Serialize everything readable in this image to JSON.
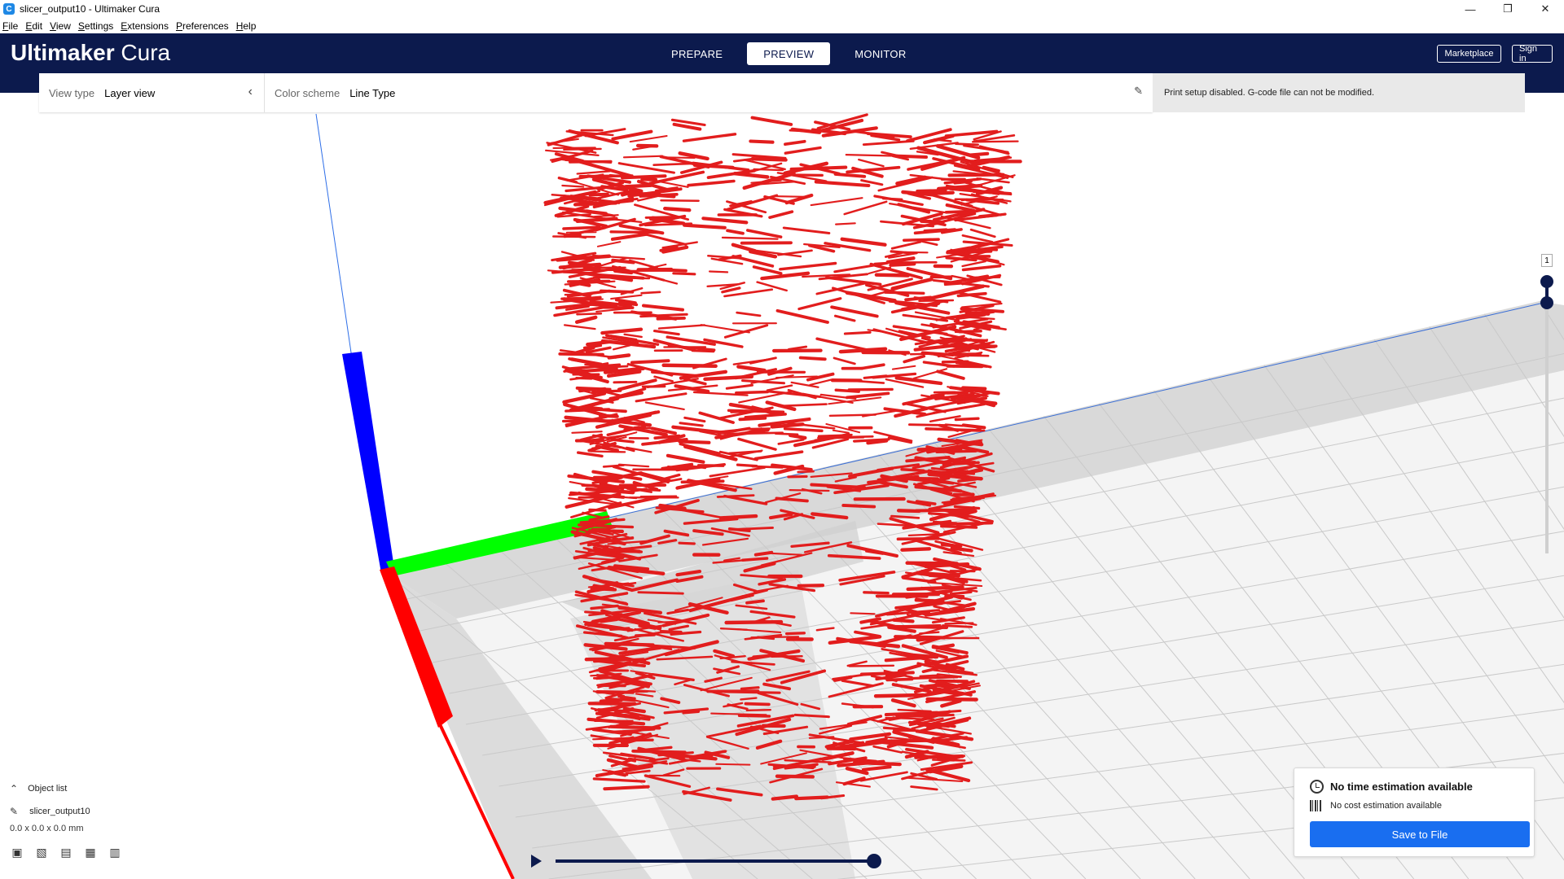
{
  "window": {
    "title": "slicer_output10 - Ultimaker Cura",
    "app_icon": "C",
    "controls": [
      "minimize-icon",
      "restore-icon",
      "close-icon"
    ]
  },
  "menubar": {
    "items": [
      "File",
      "Edit",
      "View",
      "Settings",
      "Extensions",
      "Preferences",
      "Help"
    ]
  },
  "header": {
    "logo_bold": "Ultimaker",
    "logo_light": "Cura",
    "stages": [
      {
        "label": "PREPARE",
        "active": false
      },
      {
        "label": "PREVIEW",
        "active": true
      },
      {
        "label": "MONITOR",
        "active": false
      }
    ],
    "marketplace_label": "Marketplace",
    "signin_label": "Sign in",
    "background_color": "#0c1a4d"
  },
  "view_panel": {
    "view_type_label": "View type",
    "view_type_value": "Layer view",
    "color_scheme_label": "Color scheme",
    "color_scheme_value": "Line Type",
    "print_setup_message": "Print setup disabled. G-code file can not be modified."
  },
  "layer_slider": {
    "current_layer": "1"
  },
  "object_list": {
    "toggle_label": "Object list",
    "object_name": "slicer_output10",
    "dimensions": "0.0 x 0.0 x 0.0 mm",
    "view_icons": [
      "3d-view-icon",
      "front-view-icon",
      "top-view-icon",
      "left-view-icon",
      "right-view-icon"
    ]
  },
  "estimate": {
    "time_text": "No time estimation available",
    "cost_text": "No cost estimation available",
    "save_label": "Save to File",
    "accent_color": "#196ef0"
  },
  "colors": {
    "extrusion": "#e21d1d",
    "axis_x": "#ff0000",
    "axis_y": "#00ff00",
    "axis_z": "#0000ff"
  }
}
